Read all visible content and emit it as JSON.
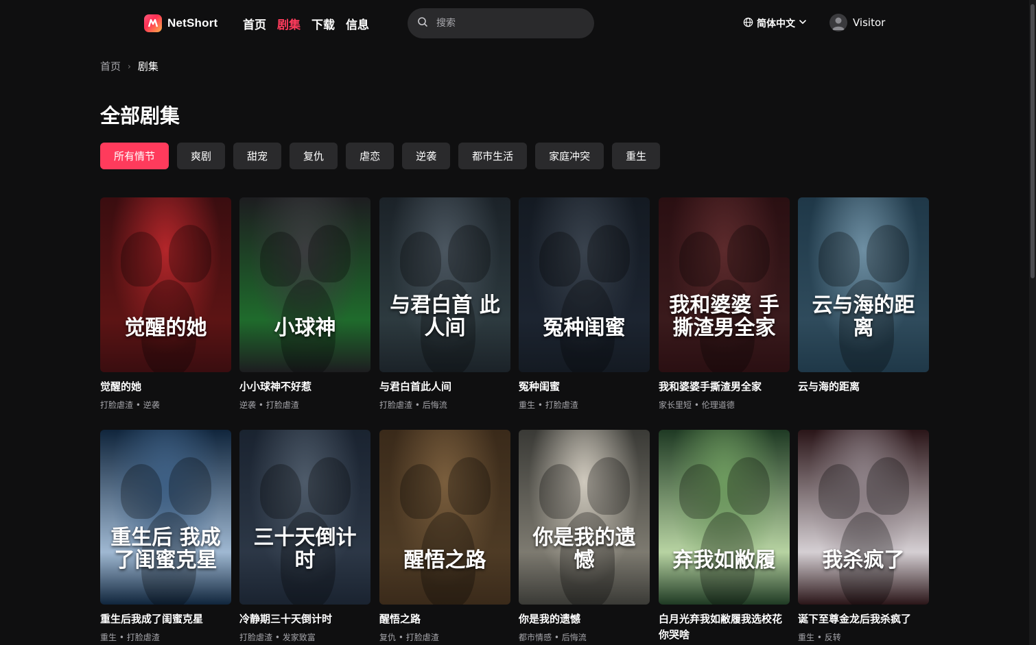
{
  "header": {
    "logo_text": "NetShort",
    "nav": [
      "首页",
      "剧集",
      "下载",
      "信息"
    ],
    "nav_active": "剧集",
    "search_placeholder": "搜索",
    "language": "简体中文",
    "user": "Visitor"
  },
  "breadcrumb": {
    "home": "首页",
    "current": "剧集"
  },
  "page_title": "全部剧集",
  "filters": [
    "所有情节",
    "爽剧",
    "甜宠",
    "复仇",
    "虐恋",
    "逆袭",
    "都市生活",
    "家庭冲突",
    "重生"
  ],
  "filter_active": "所有情节",
  "dramas": [
    {
      "title": "觉醒的她",
      "tags": "打脸虐渣 • 逆袭",
      "poster_text": "觉醒的她",
      "colors": [
        "#3a0d10",
        "#b3262a",
        "#5c1414"
      ]
    },
    {
      "title": "小小球神不好惹",
      "tags": "逆袭 • 打脸虐渣",
      "poster_text": "小球神",
      "colors": [
        "#1d1d20",
        "#3b3c3f",
        "#1f6b2c"
      ]
    },
    {
      "title": "与君白首此人间",
      "tags": "打脸虐渣 • 后悔流",
      "poster_text": "与君白首 此人间",
      "colors": [
        "#1b2228",
        "#4b5660",
        "#2d3a3f"
      ]
    },
    {
      "title": "冤种闺蜜",
      "tags": "重生 • 打脸虐渣",
      "poster_text": "冤种闺蜜",
      "colors": [
        "#141a22",
        "#39424d",
        "#1c2430"
      ]
    },
    {
      "title": "我和婆婆手撕渣男全家",
      "tags": "家长里短 • 伦理道德",
      "poster_text": "我和婆婆 手撕渣男全家",
      "colors": [
        "#2a0f12",
        "#5c2a2c",
        "#3a1a1c"
      ]
    },
    {
      "title": "云与海的距离",
      "tags": "",
      "poster_text": "云与海的距离",
      "colors": [
        "#1f3848",
        "#6e8fa3",
        "#2f4b5c"
      ]
    },
    {
      "title": "重生后我成了闺蜜克星",
      "tags": "重生 • 打脸虐渣",
      "poster_text": "重生后 我成了闺蜜克星",
      "colors": [
        "#10253c",
        "#3d5f84",
        "#9fb8d2"
      ]
    },
    {
      "title": "冷静期三十天倒计时",
      "tags": "打脸虐渣 • 发家致富",
      "poster_text": "三十天倒计时",
      "colors": [
        "#1a2330",
        "#4e5b6a",
        "#2c3746"
      ]
    },
    {
      "title": "醒悟之路",
      "tags": "复仇 • 打脸虐渣",
      "poster_text": "醒悟之路",
      "colors": [
        "#3a2a1a",
        "#7a5e3d",
        "#4e3b25"
      ]
    },
    {
      "title": "你是我的遗憾",
      "tags": "都市情感 • 后悔流",
      "poster_text": "你是我的遗憾",
      "colors": [
        "#3a3a36",
        "#cfc9bd",
        "#7d7a70"
      ]
    },
    {
      "title": "白月光弃我如敝履我选校花你哭啥",
      "tags": "",
      "poster_text": "弃我如敝履",
      "colors": [
        "#1f3a24",
        "#6d9a5e",
        "#b7d3a2"
      ]
    },
    {
      "title": "诞下至尊金龙后我杀疯了",
      "tags": "重生 • 反转",
      "poster_text": "我杀疯了",
      "colors": [
        "#2a1518",
        "#8c8086",
        "#d5cfd3"
      ]
    }
  ]
}
